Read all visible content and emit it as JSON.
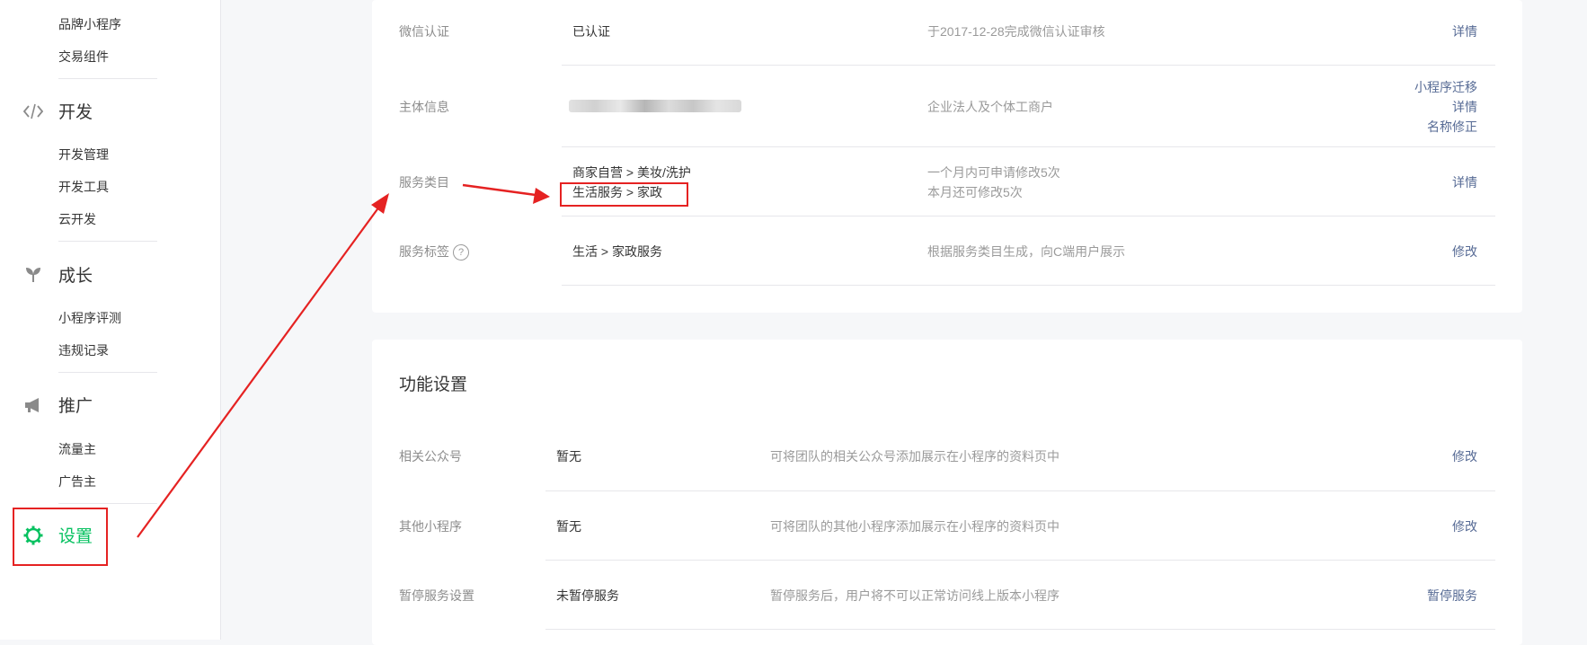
{
  "sidebar": {
    "brand_items": [
      "品牌小程序",
      "交易组件"
    ],
    "dev": {
      "title": "开发",
      "icon": "code-icon",
      "items": [
        "开发管理",
        "开发工具",
        "云开发"
      ]
    },
    "growth": {
      "title": "成长",
      "icon": "sprout-icon",
      "items": [
        "小程序评测",
        "违规记录"
      ]
    },
    "promo": {
      "title": "推广",
      "icon": "megaphone-icon",
      "items": [
        "流量主",
        "广告主"
      ]
    },
    "settings": {
      "title": "设置",
      "icon": "gear-icon"
    }
  },
  "basic_info": {
    "rows": [
      {
        "label": "微信认证",
        "value": "已认证",
        "desc": "于2017-12-28完成微信认证审核",
        "links": [
          "详情"
        ]
      },
      {
        "label": "主体信息",
        "value": "",
        "desc": "企业法人及个体工商户",
        "links": [
          "小程序迁移",
          "详情",
          "名称修正"
        ]
      },
      {
        "label": "服务类目",
        "values": [
          "商家自营 > 美妆/洗护",
          "生活服务 > 家政"
        ],
        "desc_lines": [
          "一个月内可申请修改5次",
          "本月还可修改5次"
        ],
        "links": [
          "详情"
        ]
      },
      {
        "label": "服务标签",
        "value": "生活 > 家政服务",
        "desc": "根据服务类目生成，向C端用户展示",
        "links": [
          "修改"
        ]
      }
    ]
  },
  "feature_settings": {
    "title": "功能设置",
    "rows": [
      {
        "label": "相关公众号",
        "value": "暂无",
        "desc": "可将团队的相关公众号添加展示在小程序的资料页中",
        "link": "修改"
      },
      {
        "label": "其他小程序",
        "value": "暂无",
        "desc": "可将团队的其他小程序添加展示在小程序的资料页中",
        "link": "修改"
      },
      {
        "label": "暂停服务设置",
        "value": "未暂停服务",
        "desc": "暂停服务后，用户将不可以正常访问线上版本小程序",
        "link": "暂停服务"
      }
    ]
  },
  "colors": {
    "accent": "#07c160",
    "link": "#576b95",
    "annotation": "#e52222"
  }
}
